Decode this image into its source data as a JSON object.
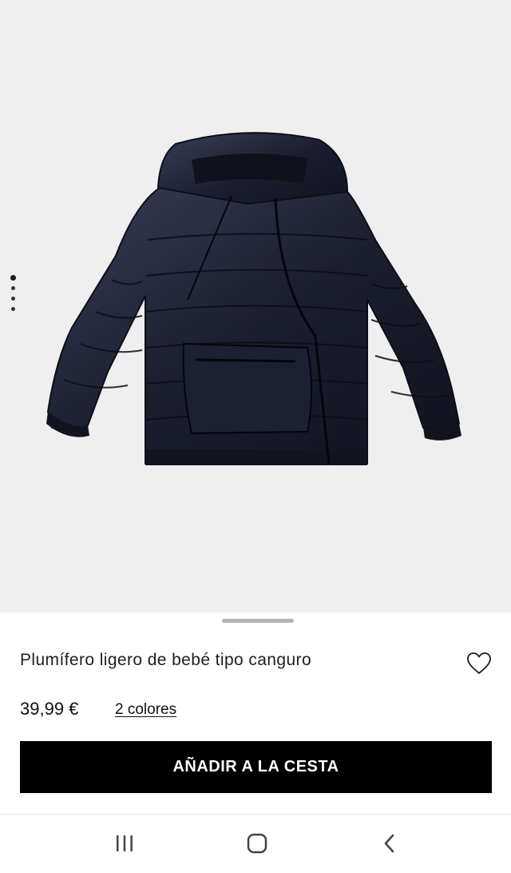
{
  "gallery": {
    "image_alt": "Plumífero ligero de bebé tipo canguro",
    "pager": {
      "count": 4,
      "active_index": 0
    }
  },
  "product": {
    "title": "Plumífero ligero de bebé tipo canguro",
    "price": "39,99 €",
    "colors_link": "2 colores",
    "add_to_cart_label": "AÑADIR A LA CESTA"
  },
  "icons": {
    "favorite": "heart-outline-icon",
    "nav_recents": "recent-apps-icon",
    "nav_home": "home-icon",
    "nav_back": "back-chevron-icon"
  },
  "colors": {
    "gallery_background": "#efefef",
    "jacket": "#1a1d2e",
    "button_background": "#000000",
    "button_text": "#ffffff"
  }
}
